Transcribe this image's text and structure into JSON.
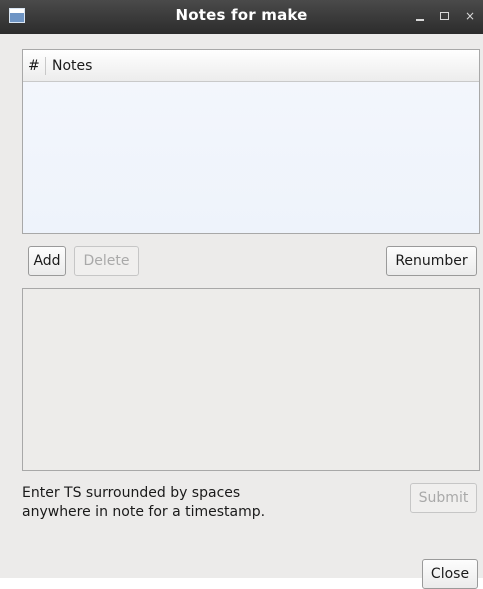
{
  "window": {
    "title": "Notes for make"
  },
  "titlebar": {
    "icons": [
      "app-icon",
      "minimize-icon",
      "maximize-icon",
      "close-icon"
    ],
    "close_glyph": "×"
  },
  "table": {
    "columns": [
      "#",
      "Notes"
    ],
    "rows": []
  },
  "buttons": {
    "add": "Add",
    "delete": "Delete",
    "renumber": "Renumber",
    "submit": "Submit",
    "close": "Close"
  },
  "editor": {
    "value": ""
  },
  "hint": {
    "line1": "Enter TS surrounded by spaces",
    "line2": "anywhere in note for a timestamp."
  },
  "colors": {
    "titlebar": "#2c2c2c",
    "window_bg": "#ecebea",
    "table_bg": "#f6f9fd"
  }
}
